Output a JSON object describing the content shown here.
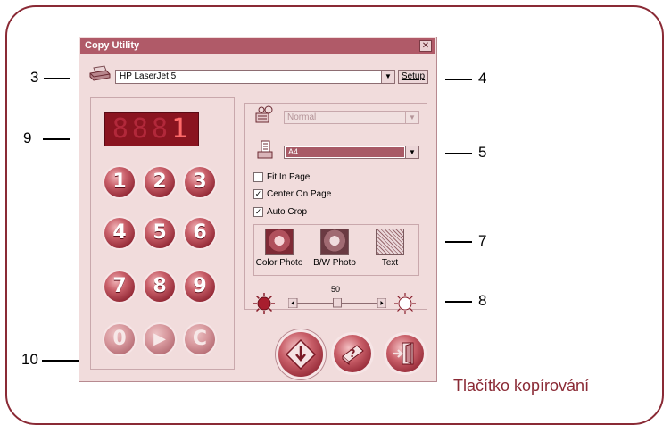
{
  "dialog": {
    "title": "Copy Utility",
    "close_glyph": "✕",
    "printer": {
      "value": "HP LaserJet 5",
      "icon": "printer-icon"
    },
    "setup_label": "Setup",
    "counter": {
      "dim_digits": "888",
      "digit": "1"
    },
    "keypad": [
      "1",
      "2",
      "3",
      "4",
      "5",
      "6",
      "7",
      "8",
      "9",
      "0",
      "▶",
      "C"
    ],
    "quality": {
      "value": "Normal",
      "enabled": false
    },
    "paper": {
      "value": "A4"
    },
    "options": [
      {
        "label": "Fit In Page",
        "checked": false
      },
      {
        "label": "Center On Page",
        "checked": true
      },
      {
        "label": "Auto Crop",
        "checked": true
      }
    ],
    "modes": [
      "Color Photo",
      "B/W Photo",
      "Text"
    ],
    "brightness": {
      "value": "50",
      "min": 0,
      "max": 100
    }
  },
  "callouts": [
    "3",
    "4",
    "5",
    "7",
    "8",
    "9",
    "10"
  ],
  "caption": "Tlačítko kopírování",
  "colors": {
    "frame": "#8a2a35",
    "accent": "#a85a66",
    "dialog_bg": "#f1dcdc"
  }
}
